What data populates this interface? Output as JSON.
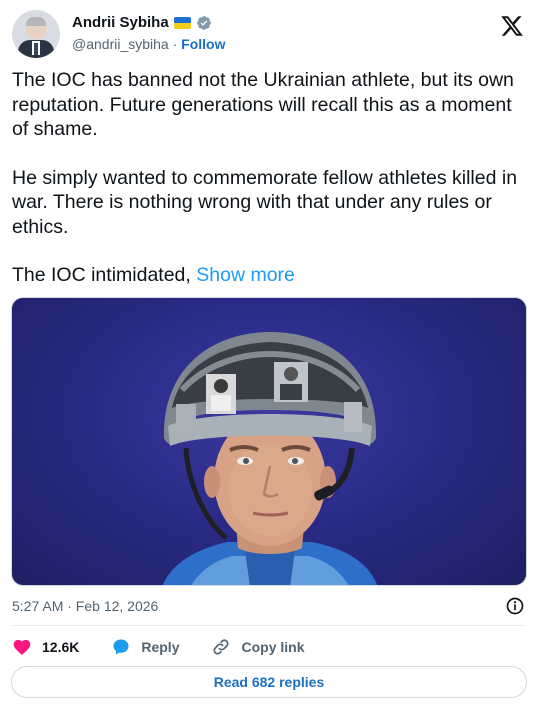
{
  "author": {
    "name": "Andrii Sybiha",
    "handle": "@andrii_sybiha",
    "separator": "·",
    "follow_label": "Follow",
    "flag_colors": [
      "#1f6fd6",
      "#f6cd1a"
    ]
  },
  "tweet": {
    "paragraphs": [
      "The IOC has banned not the Ukrainian athlete, but its own reputation. Future generations will recall this as a moment of shame.",
      "He simply wanted to commemorate fellow athletes killed in war. There is nothing wrong with that under any rules or ethics.",
      "The IOC intimidated, "
    ],
    "show_more_label": "Show more",
    "media_alt": "Athlete wearing a helmet decorated with portraits"
  },
  "meta": {
    "timestamp": "5:27 AM · Feb 12, 2026"
  },
  "actions": {
    "likes": "12.6K",
    "reply_label": "Reply",
    "copy_link_label": "Copy link"
  },
  "footer": {
    "read_replies_label": "Read 682 replies"
  },
  "colors": {
    "accent": "#1d9bf0",
    "like": "#f91880",
    "reply": "#1d9bf0",
    "text": "#0f1419",
    "muted": "#536471"
  },
  "icons": {
    "verified": "verified-badge-icon",
    "brand": "x-logo-icon",
    "info": "info-icon",
    "like": "heart-icon",
    "reply": "reply-bubble-icon",
    "copy": "link-icon"
  }
}
